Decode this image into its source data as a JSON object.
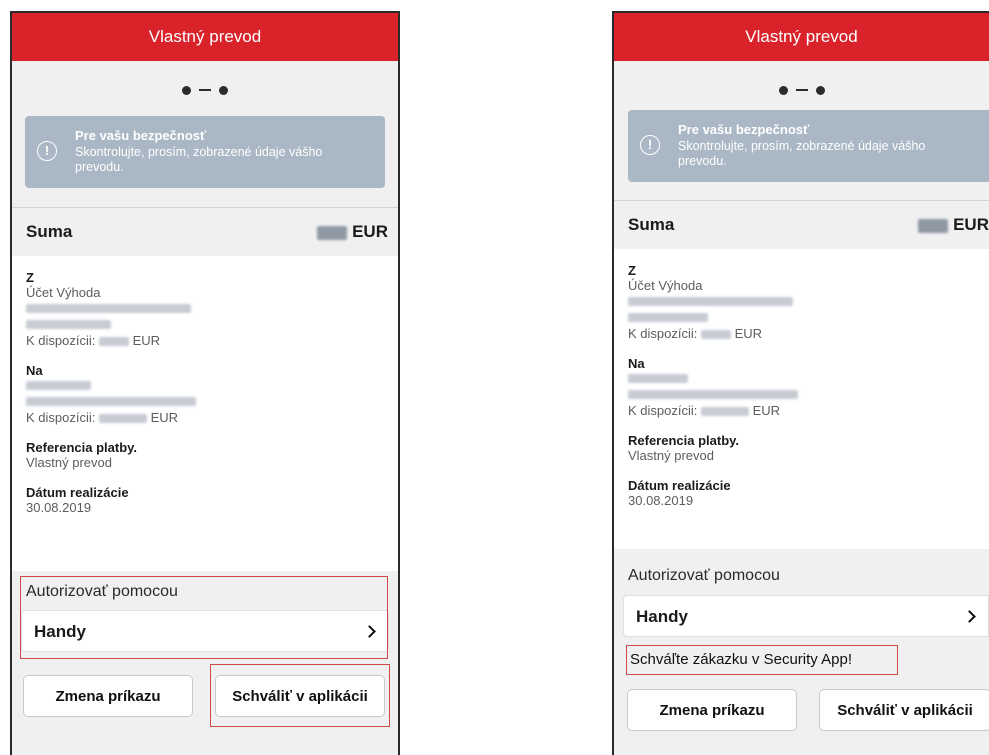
{
  "screens": [
    {
      "header_title": "Vlastný prevod",
      "notice": {
        "icon": "exclamation-circle-icon",
        "title": "Pre vašu bezpečnosť",
        "text": "Skontrolujte, prosím, zobrazené údaje vášho prevodu."
      },
      "amount": {
        "label": "Suma",
        "currency": "EUR"
      },
      "from": {
        "label": "Z",
        "account_name": "Účet Výhoda",
        "available_label": "K dispozícii:",
        "available_currency": "EUR"
      },
      "to": {
        "label": "Na",
        "available_label": "K dispozícii:",
        "available_currency": "EUR"
      },
      "reference": {
        "label": "Referencia platby.",
        "value": "Vlastný prevod"
      },
      "execution_date": {
        "label": "Dátum realizácie",
        "value": "30.08.2019"
      },
      "authorize": {
        "title": "Autorizovať pomocou",
        "method": "Handy"
      },
      "buttons": {
        "change": "Zmena príkazu",
        "approve": "Schváliť v aplikácii"
      }
    },
    {
      "header_title": "Vlastný prevod",
      "notice": {
        "icon": "exclamation-circle-icon",
        "title": "Pre vašu bezpečnosť",
        "text": "Skontrolujte, prosím, zobrazené údaje vášho prevodu."
      },
      "amount": {
        "label": "Suma",
        "currency": "EUR"
      },
      "from": {
        "label": "Z",
        "account_name": "Účet Výhoda",
        "available_label": "K dispozícii:",
        "available_currency": "EUR"
      },
      "to": {
        "label": "Na",
        "available_label": "K dispozícii:",
        "available_currency": "EUR"
      },
      "reference": {
        "label": "Referencia platby.",
        "value": "Vlastný prevod"
      },
      "execution_date": {
        "label": "Dátum realizácie",
        "value": "30.08.2019"
      },
      "authorize": {
        "title": "Autorizovať pomocou",
        "method": "Handy"
      },
      "message": "Schváľte zákazku v Security App!",
      "buttons": {
        "change": "Zmena príkazu",
        "approve": "Schváliť v aplikácii"
      }
    }
  ],
  "colors": {
    "header_red": "#d9222a",
    "notice_gray": "#aab7c4",
    "highlight_red": "#d14a4a"
  }
}
